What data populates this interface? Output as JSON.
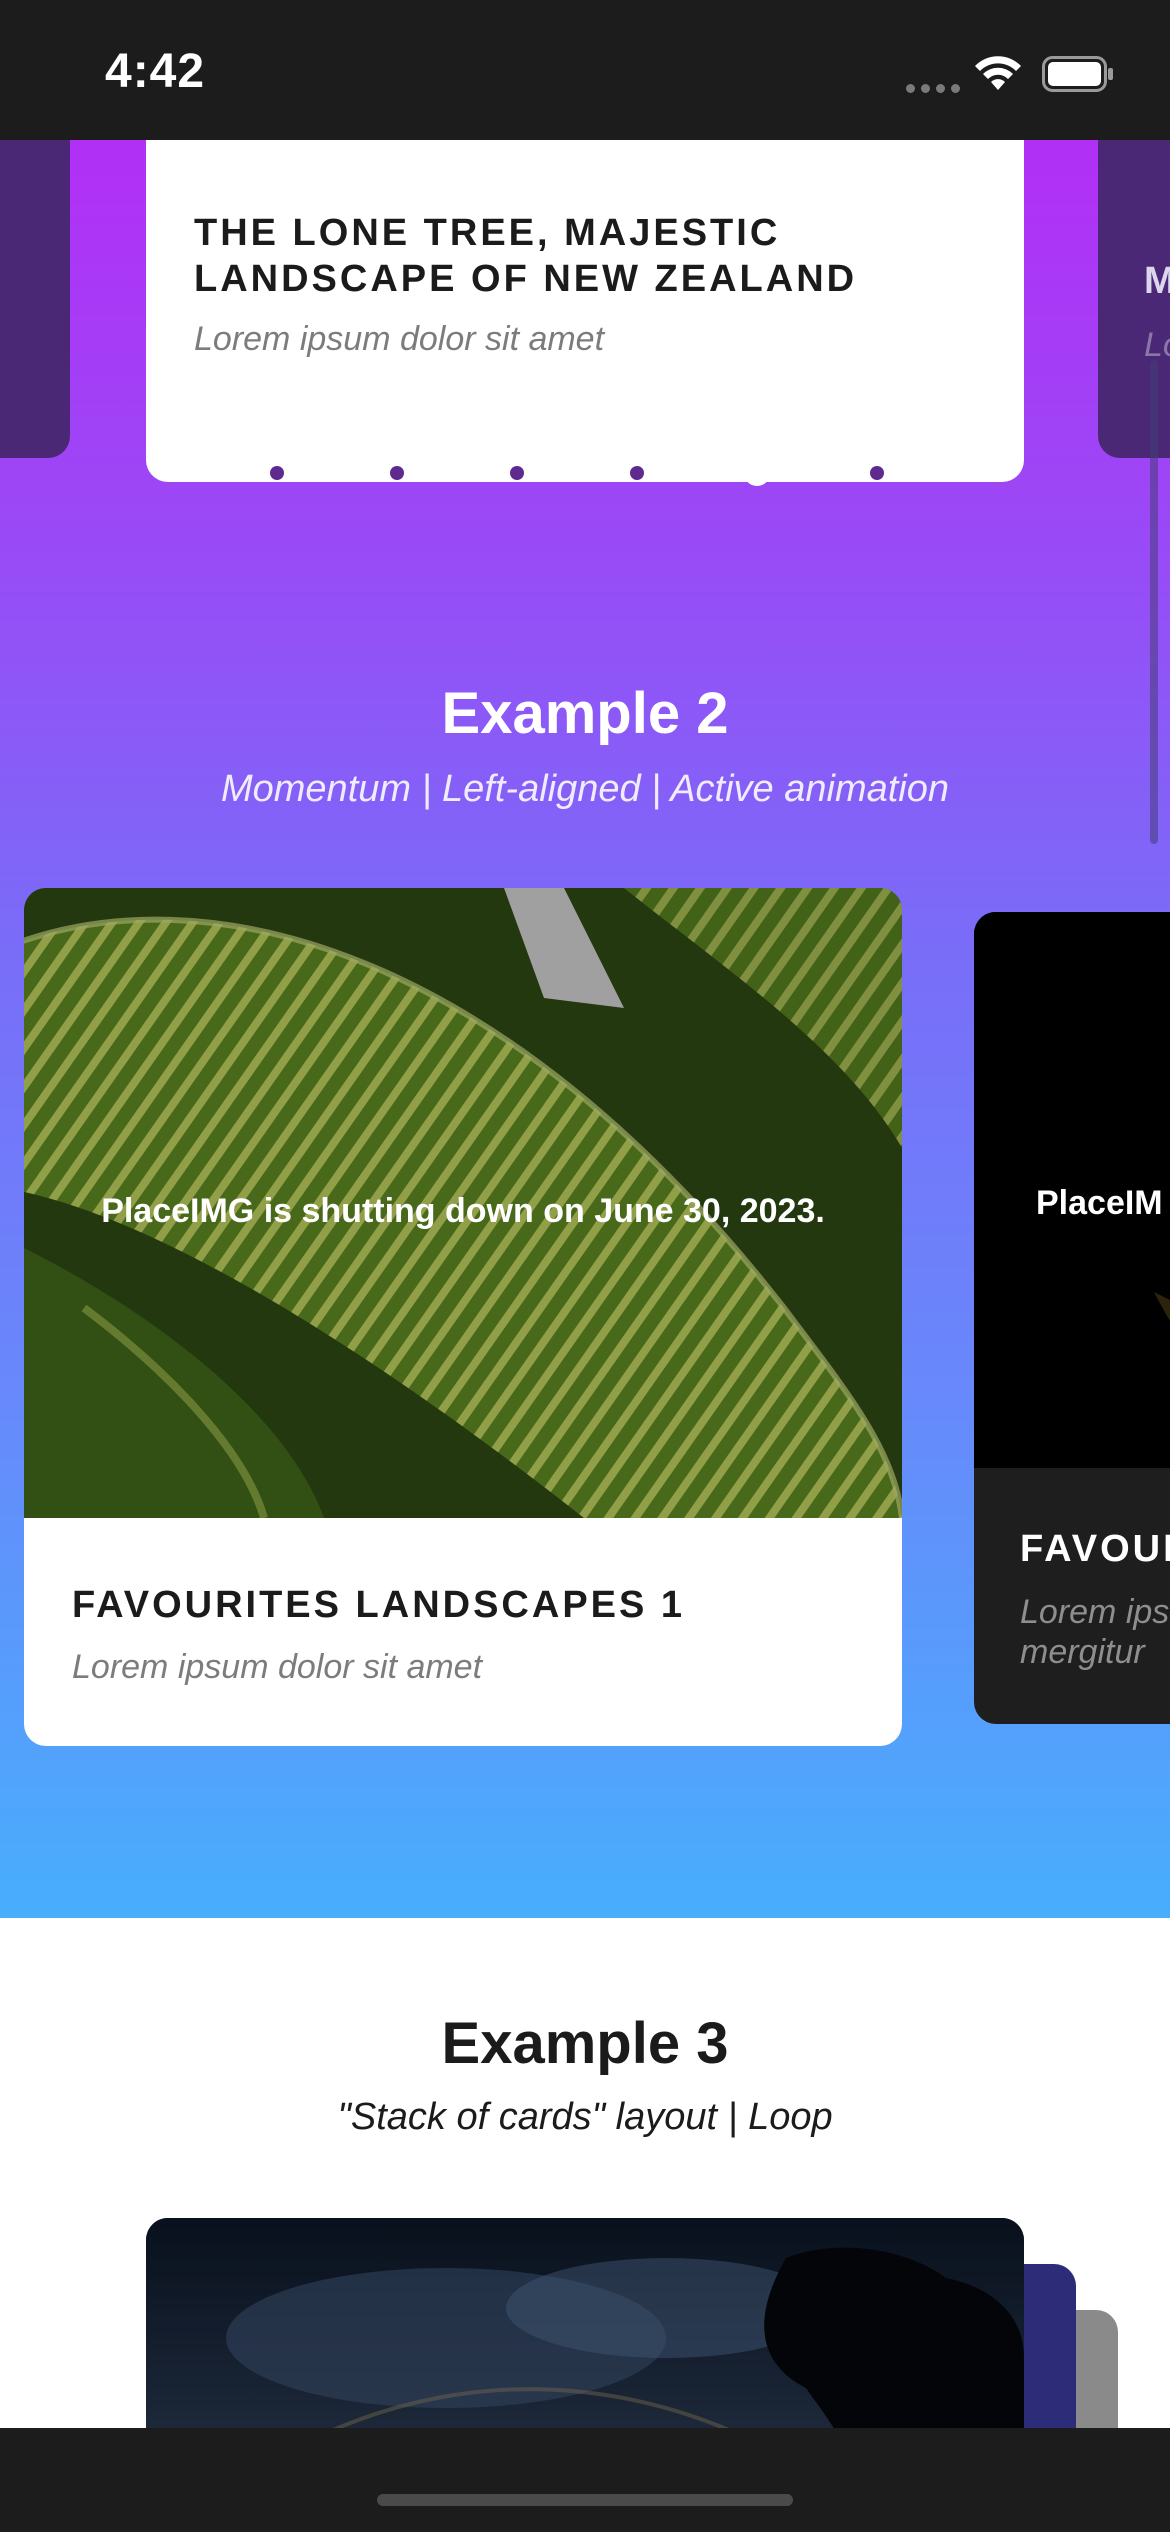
{
  "status_bar": {
    "time": "4:42"
  },
  "example1": {
    "card_title": "THE LONE TREE, MAJESTIC LANDSCAPE OF NEW ZEALAND",
    "card_subtitle": "Lorem ipsum dolor sit amet",
    "right_peek_title": "M",
    "right_peek_subtitle": "Lo",
    "pagination": {
      "count": 6,
      "active_index": 4
    }
  },
  "example2": {
    "title": "Example 2",
    "subtitle": "Momentum | Left-aligned | Active animation",
    "card": {
      "image_text": "PlaceIMG is shutting down on June 30, 2023.",
      "title": "FAVOURITES LANDSCAPES 1",
      "subtitle": "Lorem ipsum dolor sit amet"
    },
    "right_card": {
      "image_text": "PlaceIM",
      "title": "FAVOUR",
      "subtitle": "Lorem ips mergitur"
    }
  },
  "example3": {
    "title": "Example 3",
    "subtitle": "\"Stack of cards\" layout | Loop"
  },
  "colors": {
    "gradient_top": "#b22ff6",
    "gradient_bottom": "#48aefc",
    "dot_inactive": "#5e2a8f",
    "dot_active": "#ffffff"
  }
}
